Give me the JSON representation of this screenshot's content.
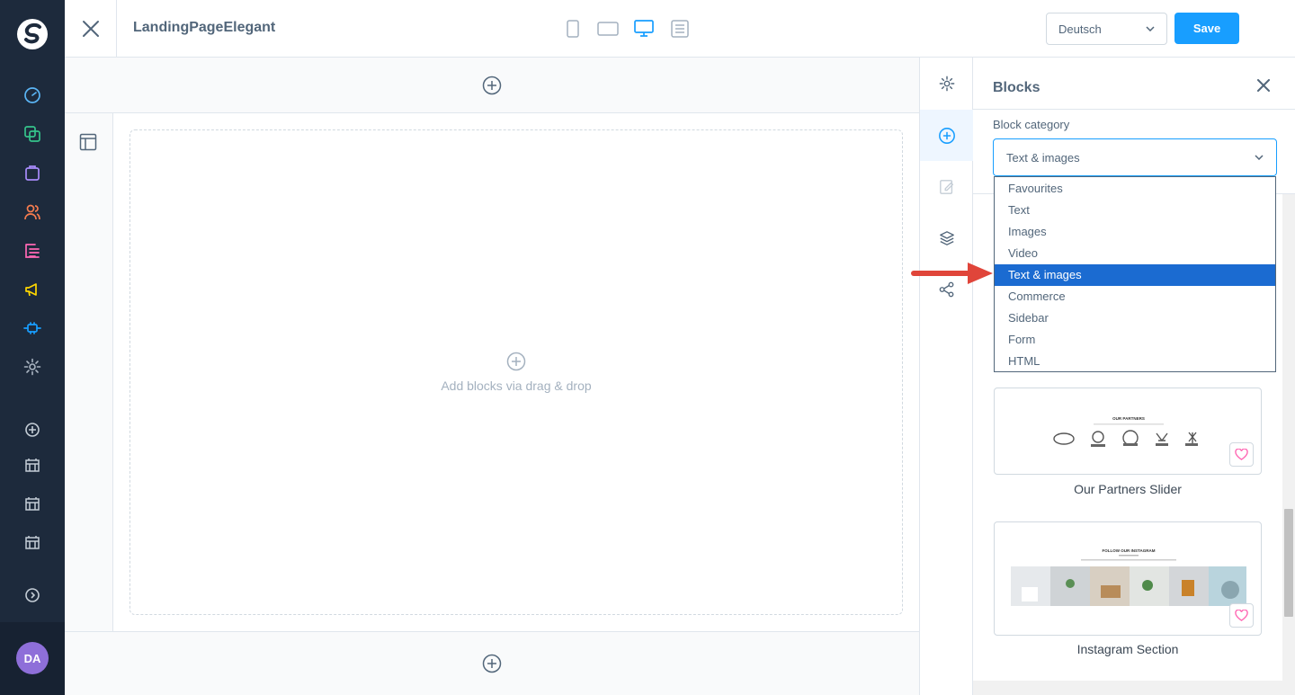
{
  "app": {
    "avatar_initials": "DA"
  },
  "topbar": {
    "page_name": "LandingPageElegant",
    "language": "Deutsch",
    "save_label": "Save"
  },
  "canvas": {
    "dropzone_text": "Add blocks via drag & drop"
  },
  "blocks_panel": {
    "title": "Blocks",
    "category_label": "Block category",
    "selected_category": "Text & images",
    "categories": [
      "Favourites",
      "Text",
      "Images",
      "Video",
      "Text & images",
      "Commerce",
      "Sidebar",
      "Form",
      "HTML"
    ],
    "blocks": [
      {
        "label": "Our Partners Slider",
        "preview_heading": "OUR PARTNERS"
      },
      {
        "label": "Instagram Section",
        "preview_heading": "FOLLOW OUR INSTAGRAM"
      }
    ]
  },
  "colors": {
    "sidebar_bg": "#1d2a3c",
    "accent": "#189eff",
    "selected_option": "#1b6bd1",
    "annotation_arrow": "#e0453a"
  }
}
